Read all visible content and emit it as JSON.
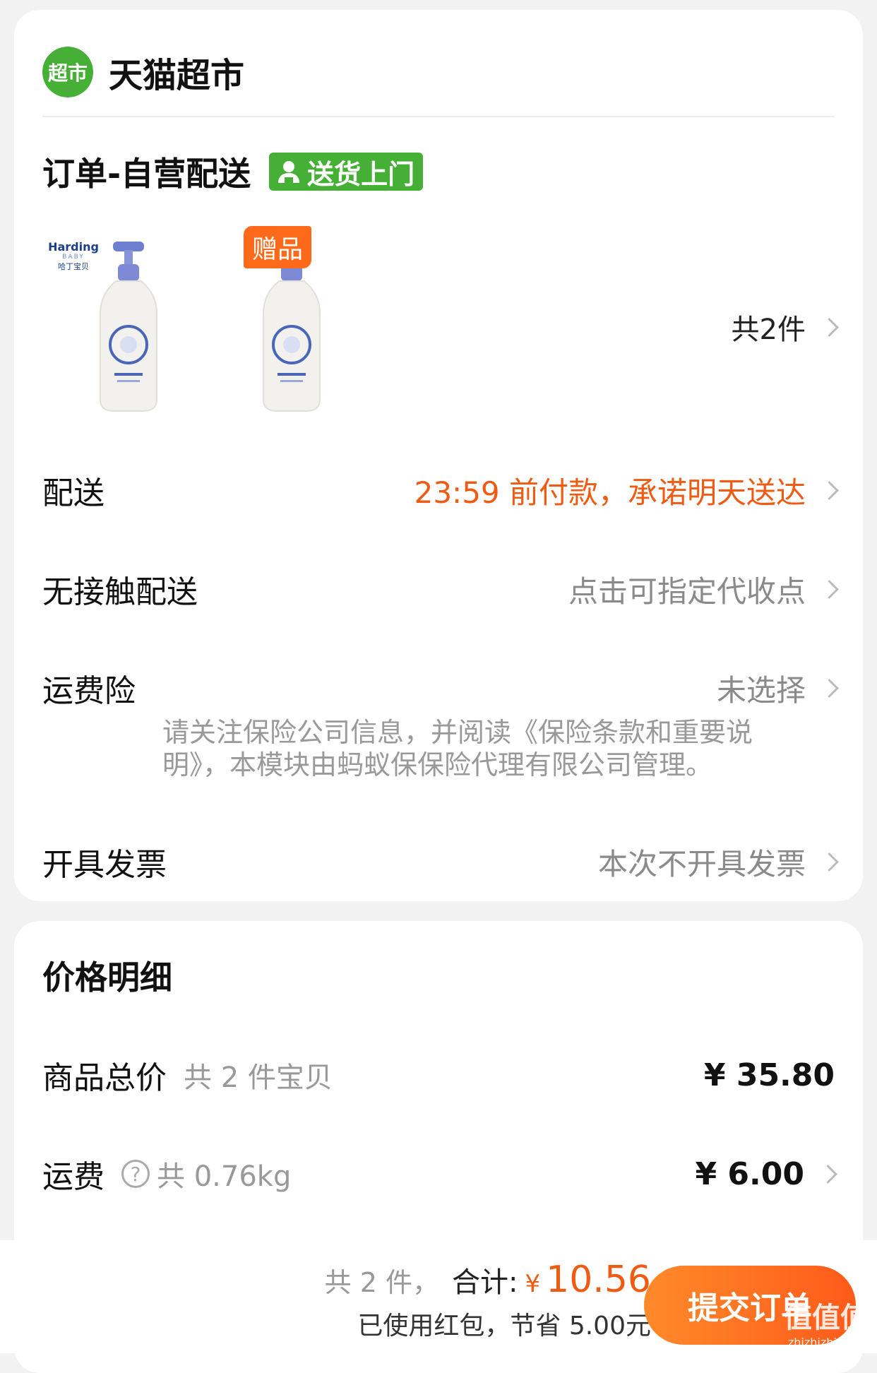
{
  "store": {
    "logo_text": "超市",
    "name": "天猫超市"
  },
  "order": {
    "title": "订单-自营配送",
    "badge": "送货上门",
    "gift_tag": "赠品",
    "product_brand": {
      "line1": "Harding",
      "line2": "BABY",
      "line3": "哈丁宝贝"
    },
    "count_label": "共2件"
  },
  "rows": {
    "delivery": {
      "label": "配送",
      "value": "23:59 前付款，承诺明天送达"
    },
    "contactless": {
      "label": "无接触配送",
      "value": "点击可指定代收点"
    },
    "insurance": {
      "label": "运费险",
      "value": "未选择",
      "note": "请关注保险公司信息，并阅读《保险条款和重要说明》，本模块由蚂蚁保保险代理有限公司管理。"
    },
    "invoice": {
      "label": "开具发票",
      "value": "本次不开具发票"
    }
  },
  "price": {
    "title": "价格明细",
    "subtotal": {
      "label": "商品总价",
      "sub": "共 2 件宝贝",
      "value": "¥ 35.80"
    },
    "shipping": {
      "label": "运费",
      "help": "?",
      "sub": "共 0.76kg",
      "value": "¥ 6.00"
    }
  },
  "bottom": {
    "count": "共 2 件，",
    "total_label": "合计:",
    "currency": "¥",
    "total": "10.56",
    "saved": "已使用红包，节省 5.00元",
    "submit": "提交订单"
  },
  "watermark": {
    "big": "值值值",
    "small": "zhizhizhi.com"
  },
  "colors": {
    "brand_green": "#45b035",
    "accent_orange": "#f05b13",
    "gift_orange": "#ff6a1a"
  }
}
